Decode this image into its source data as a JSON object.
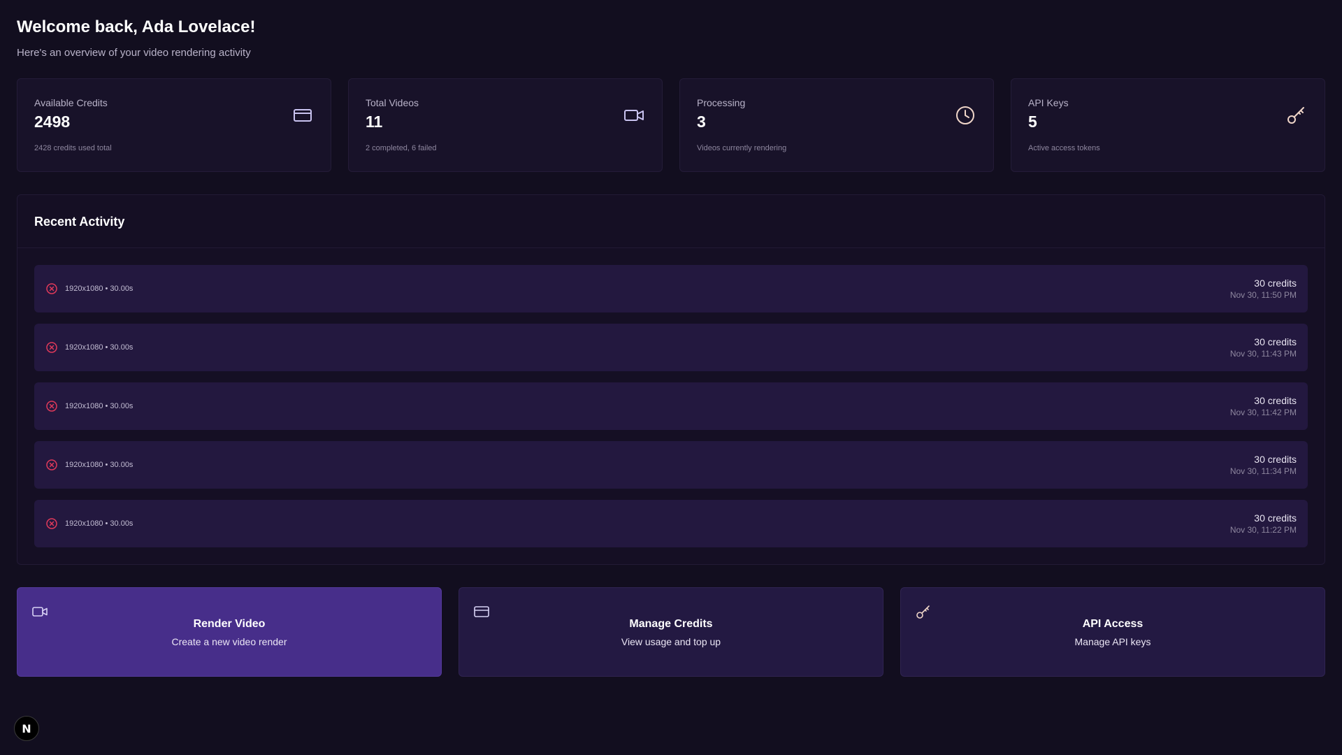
{
  "header": {
    "welcome": "Welcome back, Ada Lovelace!",
    "subtitle": "Here's an overview of your video rendering activity"
  },
  "stats": [
    {
      "label": "Available Credits",
      "value": "2498",
      "note": "2428 credits used total",
      "icon": "credit-card-icon"
    },
    {
      "label": "Total Videos",
      "value": "11",
      "note": "2 completed, 6 failed",
      "icon": "video-camera-icon"
    },
    {
      "label": "Processing",
      "value": "3",
      "note": "Videos currently rendering",
      "icon": "clock-icon"
    },
    {
      "label": "API Keys",
      "value": "5",
      "note": "Active access tokens",
      "icon": "key-icon"
    }
  ],
  "activity": {
    "title": "Recent Activity",
    "rows": [
      {
        "status": "failed",
        "desc": "1920x1080 • 30.00s",
        "credits": "30 credits",
        "time": "Nov 30, 11:50 PM"
      },
      {
        "status": "failed",
        "desc": "1920x1080 • 30.00s",
        "credits": "30 credits",
        "time": "Nov 30, 11:43 PM"
      },
      {
        "status": "failed",
        "desc": "1920x1080 • 30.00s",
        "credits": "30 credits",
        "time": "Nov 30, 11:42 PM"
      },
      {
        "status": "failed",
        "desc": "1920x1080 • 30.00s",
        "credits": "30 credits",
        "time": "Nov 30, 11:34 PM"
      },
      {
        "status": "failed",
        "desc": "1920x1080 • 30.00s",
        "credits": "30 credits",
        "time": "Nov 30, 11:22 PM"
      }
    ]
  },
  "actions": [
    {
      "title": "Render Video",
      "desc": "Create a new video render",
      "icon": "video-camera-icon"
    },
    {
      "title": "Manage Credits",
      "desc": "View usage and top up",
      "icon": "credit-card-icon"
    },
    {
      "title": "API Access",
      "desc": "Manage API keys",
      "icon": "key-icon"
    }
  ],
  "badge": {
    "label": "N"
  },
  "colors": {
    "background": "#120e1f",
    "card": "#181229",
    "row": "#23183f",
    "primary_action": "#472e8a",
    "failed": "#e0395a",
    "icon": "#c9c3f0"
  }
}
